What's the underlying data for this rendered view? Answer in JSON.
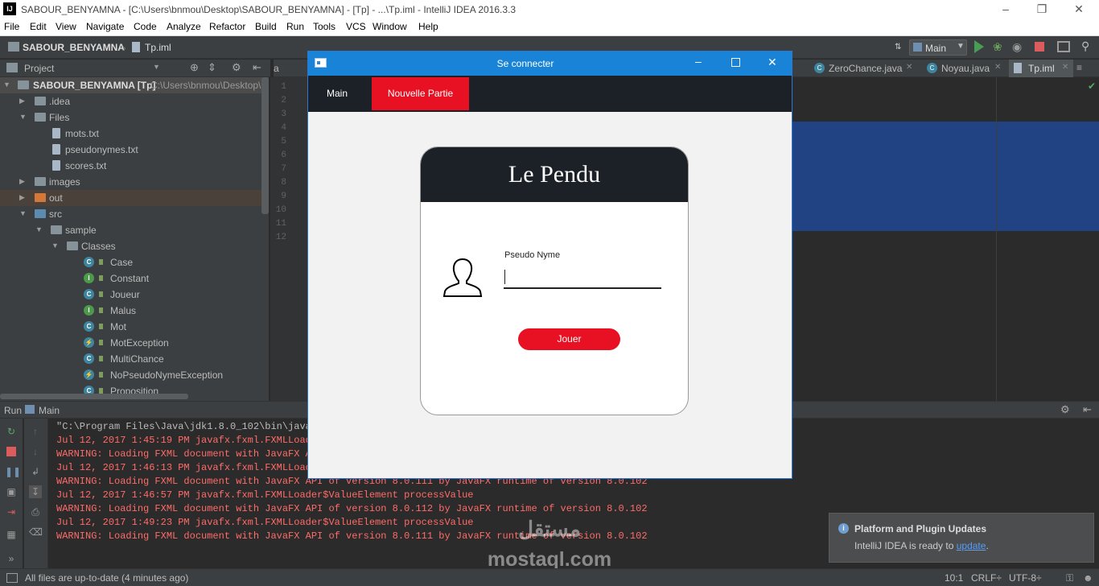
{
  "window": {
    "title": "SABOUR_BENYAMNA - [C:\\Users\\bnmou\\Desktop\\SABOUR_BENYAMNA] - [Tp] - ...\\Tp.iml - IntelliJ IDEA 2016.3.3",
    "app_badge": "IJ"
  },
  "menu": [
    "File",
    "Edit",
    "View",
    "Navigate",
    "Code",
    "Analyze",
    "Refactor",
    "Build",
    "Run",
    "Tools",
    "VCS",
    "Window",
    "Help"
  ],
  "navbar": {
    "project": "SABOUR_BENYAMNA",
    "file": "Tp.iml",
    "run_config": "Main"
  },
  "project_panel": {
    "title": "Project",
    "root": "SABOUR_BENYAMNA [Tp]",
    "root_path": "C:\\Users\\bnmou\\Desktop\\S...",
    "items": [
      {
        "label": ".idea"
      },
      {
        "label": "Files"
      },
      {
        "label": "mots.txt"
      },
      {
        "label": "pseudonymes.txt"
      },
      {
        "label": "scores.txt"
      },
      {
        "label": "images"
      },
      {
        "label": "out"
      },
      {
        "label": "src"
      },
      {
        "label": "sample"
      },
      {
        "label": "Classes"
      },
      {
        "label": "Case",
        "badge": "C"
      },
      {
        "label": "Constant",
        "badge": "I"
      },
      {
        "label": "Joueur",
        "badge": "C"
      },
      {
        "label": "Malus",
        "badge": "I"
      },
      {
        "label": "Mot",
        "badge": "C"
      },
      {
        "label": "MotException",
        "badge": "⚡"
      },
      {
        "label": "MultiChance",
        "badge": "C"
      },
      {
        "label": "NoPseudoNymeException",
        "badge": "⚡"
      },
      {
        "label": "Proposition",
        "badge": "C"
      }
    ]
  },
  "editor_tabs": [
    {
      "label": "a"
    },
    {
      "label": "ZeroChance.java"
    },
    {
      "label": "Noyau.java"
    },
    {
      "label": "Tp.iml"
    }
  ],
  "tab_overflow": "≡",
  "line_numbers": [
    "1",
    "2",
    "3",
    "4",
    "5",
    "6",
    "7",
    "8",
    "9",
    "10",
    "11",
    "12"
  ],
  "run_panel": {
    "label": "Run",
    "config": "Main",
    "lines": [
      {
        "text": "\"C:\\Program Files\\Java\\jdk1.8.0_102\\bin\\java\"",
        "kind": "cmd"
      },
      {
        "text": "Jul 12, 2017 1:45:19 PM javafx.fxml.FXMLLoader",
        "kind": "err"
      },
      {
        "text": "WARNING: Loading FXML document with JavaFX AP",
        "kind": "err"
      },
      {
        "text": "Jul 12, 2017 1:46:13 PM javafx.fxml.FXMLLoader",
        "kind": "err"
      },
      {
        "text": "WARNING: Loading FXML document with JavaFX API of version 8.0.111 by JavaFX runtime of version 8.0.102",
        "kind": "err"
      },
      {
        "text": "Jul 12, 2017 1:46:57 PM javafx.fxml.FXMLLoader$ValueElement processValue",
        "kind": "err"
      },
      {
        "text": "WARNING: Loading FXML document with JavaFX API of version 8.0.112 by JavaFX runtime of version 8.0.102",
        "kind": "err"
      },
      {
        "text": "Jul 12, 2017 1:49:23 PM javafx.fxml.FXMLLoader$ValueElement processValue",
        "kind": "err"
      },
      {
        "text": "WARNING: Loading FXML document with JavaFX API of version 8.0.111 by JavaFX runtime of version 8.0.102",
        "kind": "err"
      }
    ]
  },
  "notification": {
    "title": "Platform and Plugin Updates",
    "body": "IntelliJ IDEA is ready to",
    "link": "update",
    "tail": "."
  },
  "watermark": {
    "arabic": "مستقل",
    "latin": "mostaql.com"
  },
  "status": {
    "message": "All files are up-to-date (4 minutes ago)",
    "position": "10:1",
    "line_sep": "CRLF÷",
    "encoding": "UTF-8÷"
  },
  "dialog": {
    "title": "Se connecter",
    "nav": [
      "Main",
      "Nouvelle Partie"
    ],
    "heading": "Le Pendu",
    "field_label": "Pseudo Nyme",
    "field_value": "",
    "button": "Jouer"
  },
  "colors": {
    "accent_red": "#e81123",
    "dialog_title": "#1883d7",
    "dark_panel": "#1c2128",
    "selection_blue": "#214283"
  }
}
